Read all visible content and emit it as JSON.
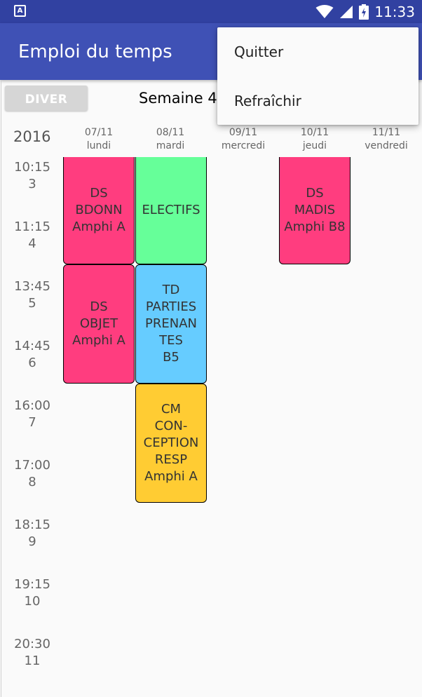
{
  "status_bar": {
    "time": "11:33",
    "icons": [
      "wifi-icon",
      "signal-icon",
      "battery-charging-icon"
    ]
  },
  "app_bar": {
    "title": "Emploi du temps"
  },
  "toolbar": {
    "diver_label": "DIVER",
    "week_label": "Semaine 45"
  },
  "calendar": {
    "year": "2016",
    "days": [
      {
        "date": "07/11",
        "name": "lundi"
      },
      {
        "date": "08/11",
        "name": "mardi"
      },
      {
        "date": "09/11",
        "name": "mercredi"
      },
      {
        "date": "10/11",
        "name": "jeudi"
      },
      {
        "date": "11/11",
        "name": "vendredi"
      }
    ],
    "time_slots": [
      {
        "time": "10:15",
        "index": "3"
      },
      {
        "time": "11:15",
        "index": "4"
      },
      {
        "time": "13:45",
        "index": "5"
      },
      {
        "time": "14:45",
        "index": "6"
      },
      {
        "time": "16:00",
        "index": "7"
      },
      {
        "time": "17:00",
        "index": "8"
      },
      {
        "time": "18:15",
        "index": "9"
      },
      {
        "time": "19:15",
        "index": "10"
      },
      {
        "time": "20:30",
        "index": "11"
      }
    ],
    "events": [
      {
        "label": "DS\nBDONN\nAmphi A",
        "color": "#ff3d7f"
      },
      {
        "label": "ELECTIFS",
        "color": "#66ff99"
      },
      {
        "label": "DS\nMADIS\nAmphi B8",
        "color": "#ff3d7f"
      },
      {
        "label": "DS\nOBJET\nAmphi A",
        "color": "#ff3d7f"
      },
      {
        "label": "TD\nPARTIES\nPRENAN\nTES\nB5",
        "color": "#66ccff"
      },
      {
        "label": "CM\nCON-\nCEPTION\nRESP\nAmphi A",
        "color": "#ffcc33"
      }
    ]
  },
  "menu": {
    "items": [
      "Quitter",
      "Refraîchir"
    ]
  }
}
